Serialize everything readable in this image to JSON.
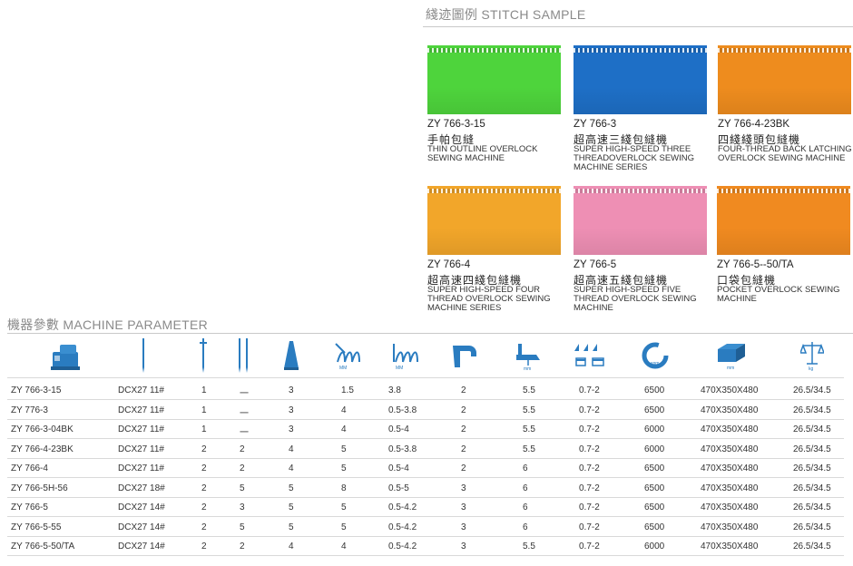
{
  "stitch_section": {
    "title": "綫迹圖例  STITCH SAMPLE"
  },
  "samples": [
    {
      "model": "ZY 766-3-15",
      "cn": "手帕包縫",
      "en": "THIN OUTLINE OVERLOCK SEWING MACHINE",
      "color": "#4ed43c"
    },
    {
      "model": "ZY 766-3",
      "cn": "超高速三綫包縫機",
      "en": "SUPER HIGH-SPEED THREE THREADOVERLOCK SEWING MACHINE SERIES",
      "color": "#1e6fc6"
    },
    {
      "model": "ZY 766-4-23BK",
      "cn": "四綫綫頭包縫機",
      "en": "FOUR-THREAD BACK LATCHING OVERLOCK SEWING MACHINE",
      "color": "#ee8c1e"
    },
    {
      "model": "ZY 766-4",
      "cn": "超高速四綫包縫機",
      "en": "SUPER HIGH-SPEED FOUR THREAD OVERLOCK SEWING MACHINE SERIES",
      "color": "#f2a62a"
    },
    {
      "model": "ZY 766-5",
      "cn": "超高速五綫包縫機",
      "en": "SUPER HIGH-SPEED FIVE THREAD OVERLOCK SEWING MACHINE",
      "color": "#ee8fb4"
    },
    {
      "model": "ZY 766-5--50/TA",
      "cn": "口袋包縫機",
      "en": "POCKET OVERLOCK SEWING MACHINE",
      "color": "#f08a20"
    }
  ],
  "param_section": {
    "title": "機器參數  MACHINE PARAMETER"
  },
  "param_icons": [
    "machine-icon",
    "needle-icon",
    "needle-count-icon",
    "double-needle-icon",
    "thread-cone-icon",
    "stitch-width-icon",
    "stitch-length-icon",
    "presser-foot-icon",
    "presser-lift-icon",
    "feed-ratio-icon",
    "speed-icon",
    "dimensions-icon",
    "weight-icon"
  ],
  "icon_labels": {
    "stitch_width": "MM",
    "stitch_length": "MM",
    "presser_lift": "mm",
    "speed": "spm",
    "dimensions": "mm",
    "weight": "kg"
  },
  "param_rows": [
    [
      "ZY 766-3-15",
      "DCX27 11#",
      "1",
      "一",
      "3",
      "1.5",
      "3.8",
      "2",
      "5.5",
      "0.7-2",
      "6500",
      "470X350X480",
      "26.5/34.5"
    ],
    [
      "ZY 776-3",
      "DCX27 11#",
      "1",
      "一",
      "3",
      "4",
      "0.5-3.8",
      "2",
      "5.5",
      "0.7-2",
      "6500",
      "470X350X480",
      "26.5/34.5"
    ],
    [
      "ZY 766-3-04BK",
      "DCX27 11#",
      "1",
      "一",
      "3",
      "4",
      "0.5-4",
      "2",
      "5.5",
      "0.7-2",
      "6000",
      "470X350X480",
      "26.5/34.5"
    ],
    [
      "ZY 766-4-23BK",
      "DCX27 11#",
      "2",
      "2",
      "4",
      "5",
      "0.5-3.8",
      "2",
      "5.5",
      "0.7-2",
      "6000",
      "470X350X480",
      "26.5/34.5"
    ],
    [
      "ZY 766-4",
      "DCX27 11#",
      "2",
      "2",
      "4",
      "5",
      "0.5-4",
      "2",
      "6",
      "0.7-2",
      "6500",
      "470X350X480",
      "26.5/34.5"
    ],
    [
      "ZY 766-5H-56",
      "DCX27 18#",
      "2",
      "5",
      "5",
      "8",
      "0.5-5",
      "3",
      "6",
      "0.7-2",
      "6500",
      "470X350X480",
      "26.5/34.5"
    ],
    [
      "ZY 766-5",
      "DCX27 14#",
      "2",
      "3",
      "5",
      "5",
      "0.5-4.2",
      "3",
      "6",
      "0.7-2",
      "6500",
      "470X350X480",
      "26.5/34.5"
    ],
    [
      "ZY 766-5-55",
      "DCX27 14#",
      "2",
      "5",
      "5",
      "5",
      "0.5-4.2",
      "3",
      "6",
      "0.7-2",
      "6500",
      "470X350X480",
      "26.5/34.5"
    ],
    [
      "ZY 766-5-50/TA",
      "DCX27 14#",
      "2",
      "2",
      "4",
      "4",
      "0.5-4.2",
      "3",
      "5.5",
      "0.7-2",
      "6000",
      "470X350X480",
      "26.5/34.5"
    ]
  ]
}
